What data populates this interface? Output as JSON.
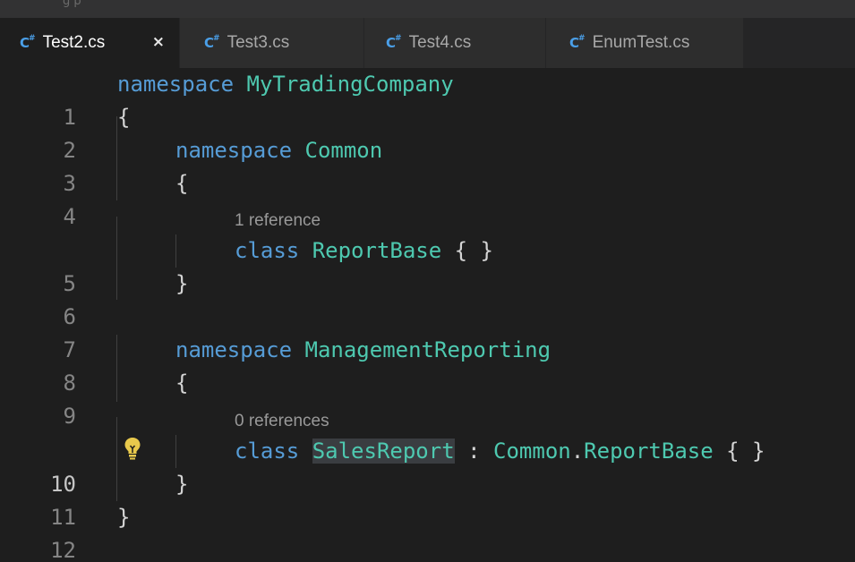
{
  "titlebar": {
    "ghost_text": "g            p"
  },
  "tabs": [
    {
      "label": "Test2.cs",
      "icon": "C#",
      "active": true,
      "close": "×"
    },
    {
      "label": "Test3.cs",
      "icon": "C#",
      "active": false
    },
    {
      "label": "Test4.cs",
      "icon": "C#",
      "active": false
    },
    {
      "label": "EnumTest.cs",
      "icon": "C#",
      "active": false
    }
  ],
  "editor": {
    "line_numbers": [
      "1",
      "2",
      "3",
      "4",
      "5",
      "6",
      "7",
      "8",
      "9",
      "10",
      "11",
      "12"
    ],
    "current_line": "10",
    "codelens": {
      "report_base": "1 reference",
      "sales_report": "0 references"
    },
    "code": {
      "l1_kw": "namespace",
      "l1_name": "MyTradingCompany",
      "l2": "{",
      "l3_kw": "namespace",
      "l3_name": "Common",
      "l4": "{",
      "l5_kw": "class",
      "l5_name": "ReportBase",
      "l5_body": "{ }",
      "l6": "}",
      "l8_kw": "namespace",
      "l8_name": "ManagementReporting",
      "l9": "{",
      "l10_kw": "class",
      "l10_name": "SalesReport",
      "l10_colon": " : ",
      "l10_ns": "Common",
      "l10_dot": ".",
      "l10_base": "ReportBase",
      "l10_body": " { }",
      "l11": "}",
      "l12": "}"
    }
  },
  "colors": {
    "keyword": "#569cd6",
    "type": "#4ec9b0",
    "lightbulb": "#e8c94c",
    "tab_icon": "#4a9fe8"
  }
}
